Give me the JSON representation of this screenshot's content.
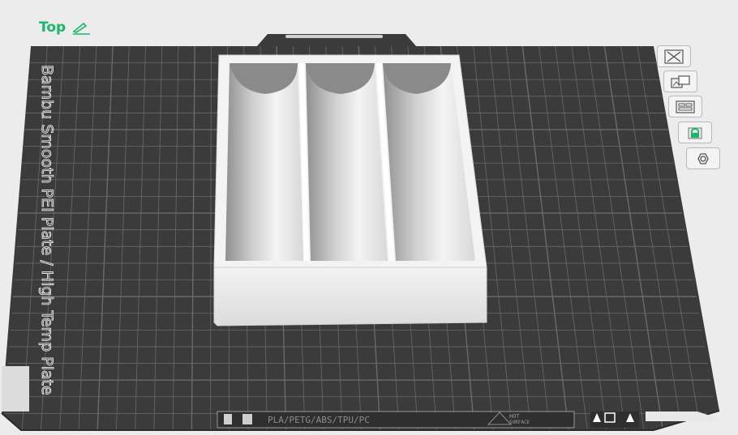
{
  "view": {
    "label": "Top"
  },
  "plate": {
    "name": "Bambu Smooth PEI Plate / High Temp Plate",
    "materials": "PLA/PETG/ABS/TPU/PC",
    "hint": "HOT\nSURFACE"
  },
  "toolbar": {
    "items": [
      {
        "icon": "close-icon"
      },
      {
        "icon": "arrange-icon"
      },
      {
        "icon": "layout-icon"
      },
      {
        "icon": "lock-icon",
        "active": true
      },
      {
        "icon": "gear-icon"
      }
    ]
  },
  "colors": {
    "background": "#ececec",
    "plate": "#3b3b3b",
    "grid": "#6a6a6a",
    "accent": "#18b86a",
    "model": "#e9e9e9"
  }
}
